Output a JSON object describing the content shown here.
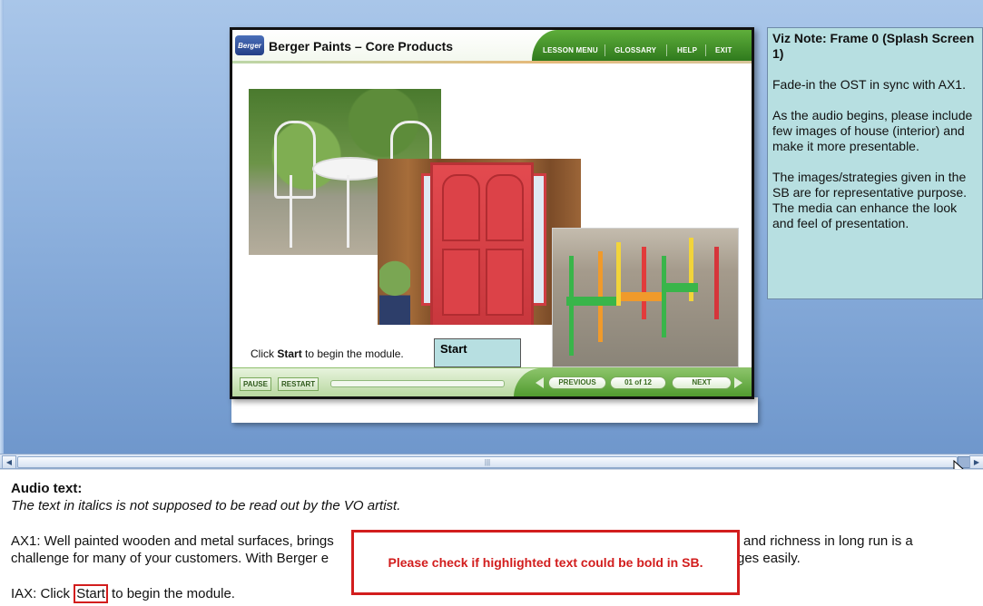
{
  "slide": {
    "logo_text": "Berger",
    "title": "Berger Paints – Core Products",
    "nav": [
      "LESSON MENU",
      "GLOSSARY",
      "HELP",
      "EXIT"
    ],
    "start_prompt_prefix": "Click ",
    "start_prompt_bold": "Start",
    "start_prompt_suffix": " to begin the module.",
    "start_button_label": "Start",
    "footer": {
      "pause_label": "PAUSE",
      "restart_label": "RESTART",
      "previous_label": "PREVIOUS",
      "page_indicator": "01 of 12",
      "next_label": "NEXT"
    }
  },
  "viz_note": {
    "title": "Viz Note: Frame 0 (Splash Screen 1)",
    "paragraphs": [
      "Fade-in the OST in sync with AX1.",
      "As the audio begins, please include few images of house (interior) and make it more presentable.",
      "The images/strategies given in the SB are for representative purpose. The media can enhance the look and feel of presentation."
    ]
  },
  "notes": {
    "heading": "Audio text:",
    "italic_note": "The text in italics is not supposed to be read out by the VO artist.",
    "ax1_line1": "AX1: Well painted wooden and metal surfaces, brings",
    "ax1_line1_end": "and richness in long run is a",
    "ax1_line2": "challenge for many of your customers. With Berger e",
    "ax1_line2_end": "ges easily.",
    "iax_prefix": "IAX: Click ",
    "iax_highlight": "Start",
    "iax_suffix": " to begin the module."
  },
  "review_callout": "Please check if highlighted text could be bold in SB.",
  "colors": {
    "accent_green": "#4f9a2d",
    "note_bg": "#b7dfe1",
    "callout_red": "#d21d1d"
  }
}
